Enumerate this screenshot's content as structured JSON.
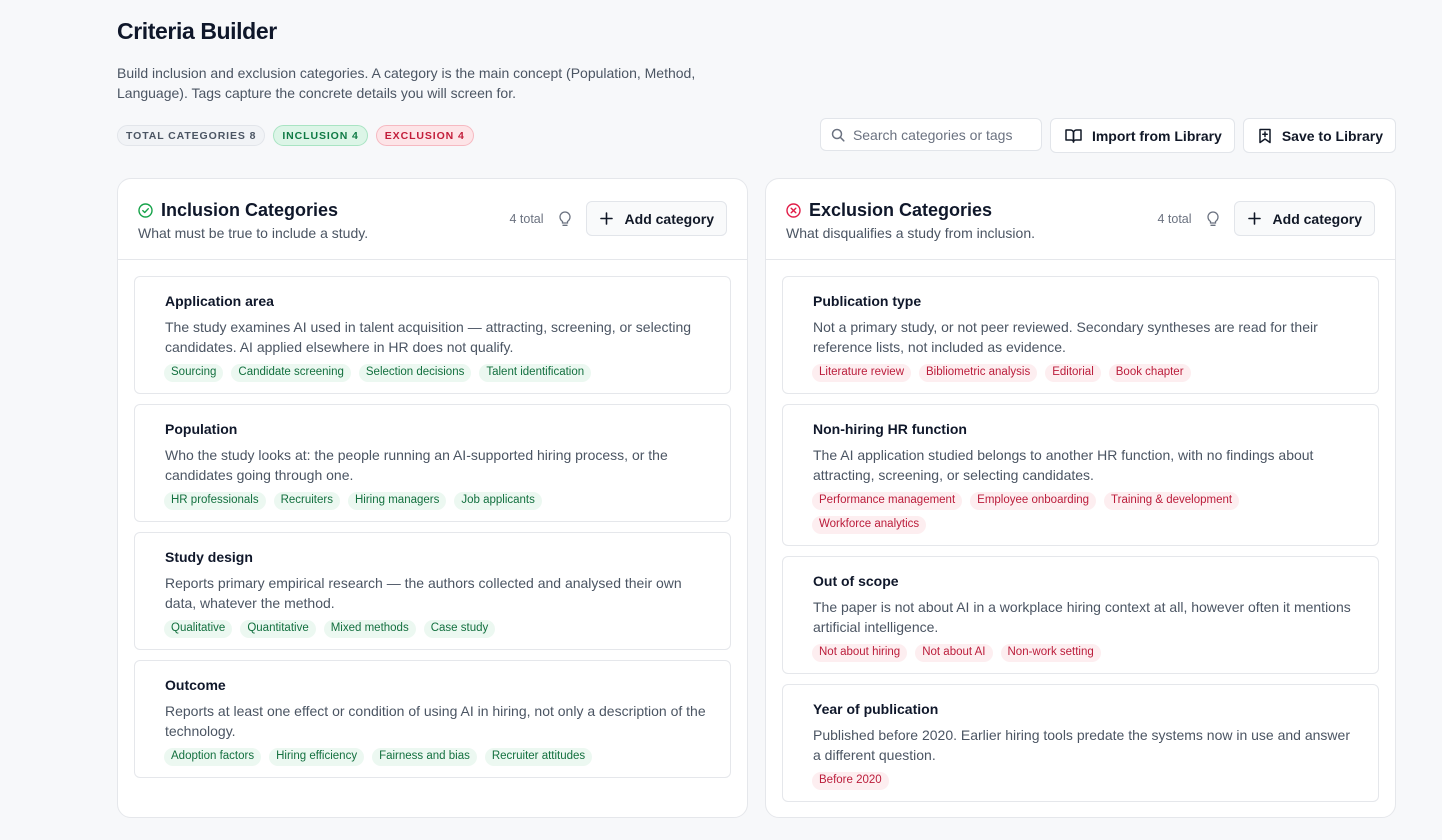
{
  "page": {
    "title": "Criteria Builder",
    "subtitle": "Build inclusion and exclusion categories. A category is the main concept (Population, Method, Language). Tags capture the concrete details you will screen for."
  },
  "stats": {
    "total": "TOTAL CATEGORIES 8",
    "inclusion": "INCLUSION 4",
    "exclusion": "EXCLUSION 4"
  },
  "toolbar": {
    "search_placeholder": "Search categories or tags",
    "import_label": "Import from Library",
    "save_label": "Save to Library"
  },
  "inclusion": {
    "title": "Inclusion Categories",
    "subtitle": "What must be true to include a study.",
    "count": "4 total",
    "add_label": "Add category",
    "accent": "#16a34a",
    "cards": [
      {
        "title": "Application area",
        "desc": "The study examines AI used in talent acquisition — attracting, screening, or selecting candidates. AI applied elsewhere in HR does not qualify.",
        "tags": [
          "Sourcing",
          "Candidate screening",
          "Selection decisions",
          "Talent identification"
        ]
      },
      {
        "title": "Population",
        "desc": "Who the study looks at: the people running an AI-supported hiring process, or the candidates going through one.",
        "tags": [
          "HR professionals",
          "Recruiters",
          "Hiring managers",
          "Job applicants"
        ]
      },
      {
        "title": "Study design",
        "desc": "Reports primary empirical research — the authors collected and analysed their own data, whatever the method.",
        "tags": [
          "Qualitative",
          "Quantitative",
          "Mixed methods",
          "Case study"
        ]
      },
      {
        "title": "Outcome",
        "desc": "Reports at least one effect or condition of using AI in hiring, not only a description of the technology.",
        "tags": [
          "Adoption factors",
          "Hiring efficiency",
          "Fairness and bias",
          "Recruiter attitudes"
        ]
      }
    ]
  },
  "exclusion": {
    "title": "Exclusion Categories",
    "subtitle": "What disqualifies a study from inclusion.",
    "count": "4 total",
    "add_label": "Add category",
    "accent": "#e11d48",
    "cards": [
      {
        "title": "Publication type",
        "desc": "Not a primary study, or not peer reviewed. Secondary syntheses are read for their reference lists, not included as evidence.",
        "tags": [
          "Literature review",
          "Bibliometric analysis",
          "Editorial",
          "Book chapter"
        ]
      },
      {
        "title": "Non-hiring HR function",
        "desc": "The AI application studied belongs to another HR function, with no findings about attracting, screening, or selecting candidates.",
        "tags": [
          "Performance management",
          "Employee onboarding",
          "Training & development",
          "Workforce analytics"
        ]
      },
      {
        "title": "Out of scope",
        "desc": "The paper is not about AI in a workplace hiring context at all, however often it mentions artificial intelligence.",
        "tags": [
          "Not about hiring",
          "Not about AI",
          "Non-work setting"
        ]
      },
      {
        "title": "Year of publication",
        "desc": "Published before 2020. Earlier hiring tools predate the systems now in use and answer a different question.",
        "tags": [
          "Before 2020"
        ]
      }
    ]
  }
}
